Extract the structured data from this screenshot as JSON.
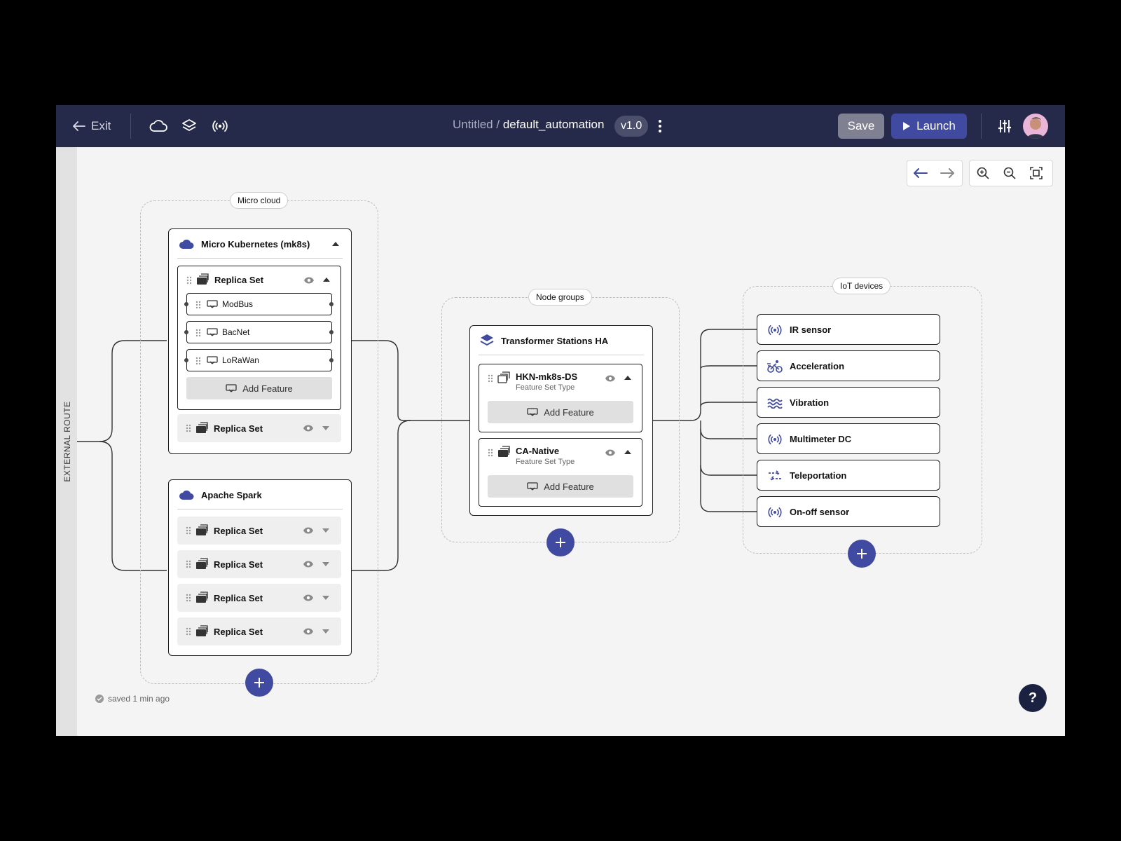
{
  "topbar": {
    "exit_label": "Exit",
    "crumb_parent": "Untitled /",
    "crumb_current": "default_automation",
    "version": "v1.0",
    "save_label": "Save",
    "launch_label": "Launch"
  },
  "sidebar": {
    "external_route_label": "EXTERNAL ROUTE"
  },
  "groups": {
    "micro_cloud": "Micro cloud",
    "node_groups": "Node groups",
    "iot_devices": "IoT devices"
  },
  "mk8s": {
    "title": "Micro Kubernetes (mk8s)",
    "replica_open": "Replica Set",
    "features": [
      "ModBus",
      "BacNet",
      "LoRaWan"
    ],
    "add_feature": "Add Feature",
    "replica_closed": "Replica Set"
  },
  "spark": {
    "title": "Apache Spark",
    "replicas": [
      "Replica Set",
      "Replica Set",
      "Replica Set",
      "Replica Set"
    ]
  },
  "transformer": {
    "title": "Transformer Stations HA",
    "sets": [
      {
        "title": "HKN-mk8s-DS",
        "subtitle": "Feature Set Type",
        "add_feature": "Add Feature"
      },
      {
        "title": "CA-Native",
        "subtitle": "Feature Set Type",
        "add_feature": "Add Feature"
      }
    ]
  },
  "devices": [
    {
      "label": "IR sensor",
      "icon": "broadcast-icon"
    },
    {
      "label": "Acceleration",
      "icon": "bike-speed-icon"
    },
    {
      "label": "Vibration",
      "icon": "waves-icon"
    },
    {
      "label": "Multimeter DC",
      "icon": "broadcast-icon"
    },
    {
      "label": "Teleportation",
      "icon": "transfer-icon"
    },
    {
      "label": "On-off sensor",
      "icon": "broadcast-icon"
    }
  ],
  "footer": {
    "saved_text": "saved 1 min ago",
    "help_label": "?"
  },
  "colors": {
    "topbar": "#262a4a",
    "accent": "#3f4aa0",
    "canvas": "#f4f4f4"
  }
}
